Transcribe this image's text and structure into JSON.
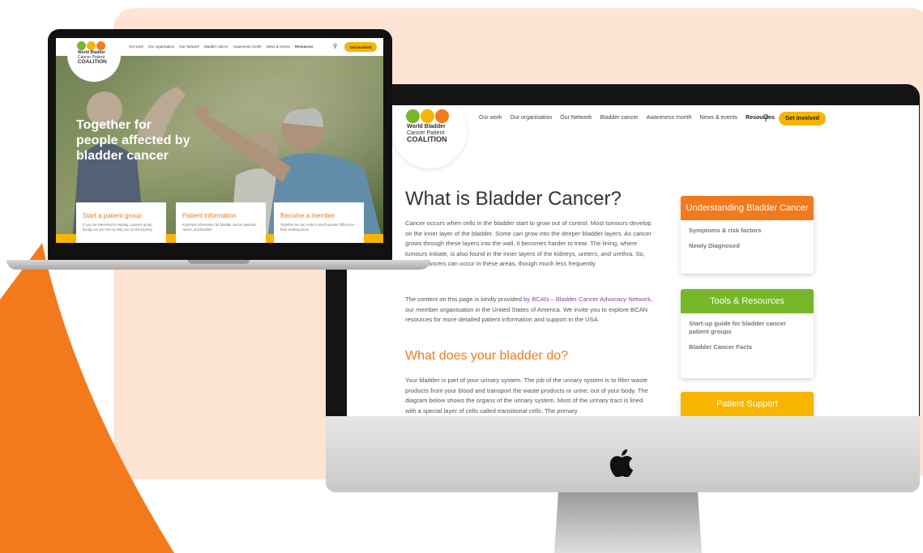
{
  "colors": {
    "accent_orange": "#f27a1d",
    "accent_green": "#76b82a",
    "accent_yellow": "#f7b500",
    "link_purple": "#8e3fa6",
    "panel_peach": "#fde4d4"
  },
  "brand": {
    "line1": "World Bladder",
    "line2": "Cancer Patient",
    "line3": "COALITION"
  },
  "nav": {
    "items": [
      "Our work",
      "Our organisation",
      "Our Network",
      "Bladder cancer",
      "Awareness month",
      "News & events",
      "Resources"
    ],
    "search_icon": "search-icon",
    "cta": "Get involved"
  },
  "desktop": {
    "title": "What is Bladder Cancer?",
    "p1": "Cancer occurs when cells in the bladder start to grow out of control. Most tumours develop on the inner layer of the bladder. Some can grow into the deeper bladder layers. As cancer grows through these layers into the wall, it becomes harder to treat. The lining, where tumours initiate, is also found in the inner layers of the kidneys, ureters, and urethra. So, similar cancers can occur in these areas, though much less frequently.",
    "p2_before": "The content on this page is kindly provided ",
    "p2_link": "by BCAN – Bladder Cancer Advocacy Network",
    "p2_after": ", our member organisation in the United States of America. We invite you to explore BCAN resources for more detailed patient information and support in the USA.",
    "subtitle": "What does your bladder do?",
    "p3": "Your bladder is part of your urinary system. The job of the urinary system is to filter waste products from your blood and transport the waste products or urine, out of your body. The diagram below shows the organs of the urinary system. Most of the urinary tract is lined with a special layer of cells called transitional cells. The primary",
    "sidebar": {
      "understanding": {
        "title": "Understanding Bladder Cancer",
        "links": [
          "Symptoms & risk factors",
          "Newly Diagnosed"
        ]
      },
      "tools": {
        "title": "Tools & Resources",
        "links": [
          "Start-up guide for bladder cancer patient groups",
          "Bladder Cancer Facts"
        ]
      },
      "support": {
        "title": "Patient Support"
      }
    }
  },
  "laptop": {
    "hero_line1": "Together for",
    "hero_line2": "people affected by",
    "hero_line3": "bladder cancer",
    "cards": [
      {
        "title": "Start a patient group",
        "desc": "If you are interested in starting a patient group locally, we are here to help you on this journey."
      },
      {
        "title": "Patient information",
        "desc": "Important information for bladder cancer patients, carers, and families"
      },
      {
        "title": "Become a member",
        "desc": "Together we can make a much greater difference than working alone"
      }
    ]
  }
}
